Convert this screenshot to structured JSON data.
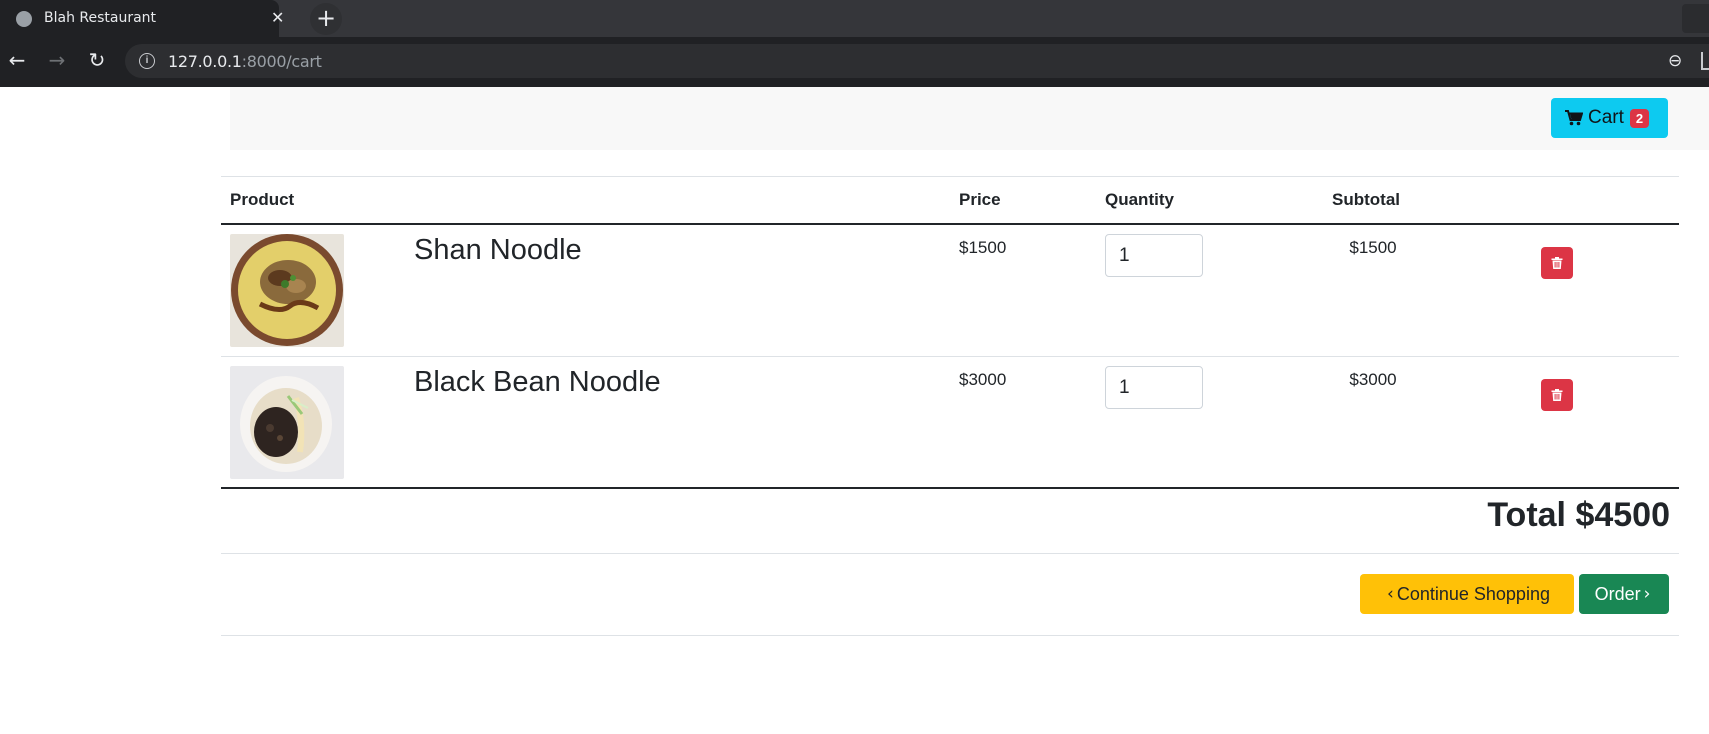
{
  "browser": {
    "tab_title": "Blah Restaurant",
    "tab_close": "✕",
    "new_tab": "+",
    "url_host": "127.0.0.1",
    "url_rest": ":8000/cart"
  },
  "header": {
    "cart_label": "Cart",
    "cart_count": "2"
  },
  "table": {
    "columns": [
      "Product",
      "Price",
      "Quantity",
      "Subtotal"
    ],
    "rows": [
      {
        "name": "Shan Noodle",
        "price": "$1500",
        "quantity": "1",
        "subtotal": "$1500"
      },
      {
        "name": "Black Bean Noodle",
        "price": "$3000",
        "quantity": "1",
        "subtotal": "$3000"
      }
    ]
  },
  "total_label": "Total $4500",
  "actions": {
    "continue_label": "Continue Shopping",
    "order_label": "Order"
  },
  "colors": {
    "cart_button": "#0dcaf0",
    "badge": "#dc3545",
    "delete_button": "#dc3545",
    "continue_button": "#ffc107",
    "order_button": "#198754"
  },
  "icons": [
    "globe-icon",
    "close-icon",
    "plus-icon",
    "back-arrow-icon",
    "forward-arrow-icon",
    "reload-icon",
    "info-icon",
    "zoom-out-icon",
    "cart-icon",
    "trash-icon",
    "chevron-left-icon",
    "chevron-right-icon"
  ]
}
